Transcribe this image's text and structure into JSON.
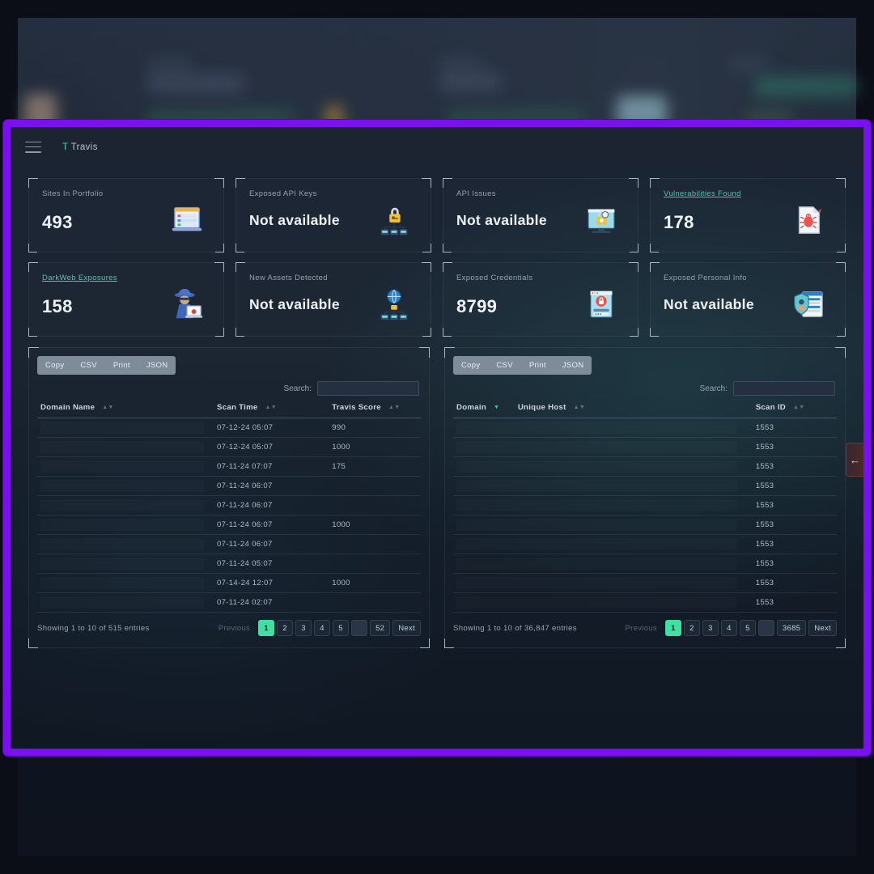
{
  "header": {
    "brand_initial": "T",
    "brand_name": "Travis",
    "menu_icon": "hamburger-icon"
  },
  "accent": {
    "teal": "#3ccfae",
    "green": "#3ee0a6",
    "frame_purple": "#7b0ff0"
  },
  "kpi_cards": [
    {
      "label": "Sites In Portfolio",
      "value": "493",
      "is_link": false,
      "icon": "domains-browser-icon"
    },
    {
      "label": "Exposed API Keys",
      "value": "Not available",
      "is_link": false,
      "icon": "api-key-lock-network-icon"
    },
    {
      "label": "API Issues",
      "value": "Not available",
      "is_link": false,
      "icon": "api-lock-gear-monitor-icon"
    },
    {
      "label": "Vulnerabilities Found",
      "value": "178",
      "is_link": true,
      "icon": "bug-document-icon"
    },
    {
      "label": "DarkWeb Exposures",
      "value": "158",
      "is_link": true,
      "icon": "hacker-spy-laptop-icon"
    },
    {
      "label": "New Assets Detected",
      "value": "Not available",
      "is_link": false,
      "icon": "globe-network-assets-icon"
    },
    {
      "label": "Exposed Credentials",
      "value": "8799",
      "is_link": false,
      "icon": "credentials-lock-form-icon"
    },
    {
      "label": "Exposed Personal Info",
      "value": "Not available",
      "is_link": false,
      "icon": "personal-info-shield-icon"
    }
  ],
  "export_buttons": [
    "Copy",
    "CSV",
    "Print",
    "JSON"
  ],
  "search": {
    "label": "Search:",
    "value": "",
    "placeholder": ""
  },
  "left_table": {
    "columns": [
      {
        "label": "Domain Name",
        "sorted": false
      },
      {
        "label": "Scan Time",
        "sorted": false
      },
      {
        "label": "Travis Score",
        "sorted": false
      }
    ],
    "rows": [
      {
        "domain": "",
        "scan_time": "07-12-24 05:07",
        "score": "990"
      },
      {
        "domain": "",
        "scan_time": "07-12-24 05:07",
        "score": "1000"
      },
      {
        "domain": "",
        "scan_time": "07-11-24 07:07",
        "score": "175"
      },
      {
        "domain": "",
        "scan_time": "07-11-24 06:07",
        "score": ""
      },
      {
        "domain": "",
        "scan_time": "07-11-24 06:07",
        "score": ""
      },
      {
        "domain": "",
        "scan_time": "07-11-24 06:07",
        "score": "1000"
      },
      {
        "domain": "",
        "scan_time": "07-11-24 06:07",
        "score": ""
      },
      {
        "domain": "",
        "scan_time": "07-11-24 05:07",
        "score": ""
      },
      {
        "domain": "",
        "scan_time": "07-14-24 12:07",
        "score": "1000"
      },
      {
        "domain": "",
        "scan_time": "07-11-24 02:07",
        "score": ""
      }
    ],
    "showing": "Showing 1 to 10 of 515 entries",
    "pager": {
      "previous": "Previous",
      "pages": [
        "1",
        "2",
        "3",
        "4",
        "5",
        "…",
        "52"
      ],
      "current": "1",
      "next": "Next"
    }
  },
  "right_table": {
    "columns": [
      {
        "label": "Domain",
        "sorted": true
      },
      {
        "label": "Unique Host",
        "sorted": false
      },
      {
        "label": "Scan ID",
        "sorted": false
      }
    ],
    "rows": [
      {
        "domain": "",
        "unique_host": "",
        "scan_id": "1553"
      },
      {
        "domain": "",
        "unique_host": "",
        "scan_id": "1553"
      },
      {
        "domain": "",
        "unique_host": "",
        "scan_id": "1553"
      },
      {
        "domain": "",
        "unique_host": "",
        "scan_id": "1553"
      },
      {
        "domain": "",
        "unique_host": "",
        "scan_id": "1553"
      },
      {
        "domain": "",
        "unique_host": "",
        "scan_id": "1553"
      },
      {
        "domain": "",
        "unique_host": "",
        "scan_id": "1553"
      },
      {
        "domain": "",
        "unique_host": "",
        "scan_id": "1553"
      },
      {
        "domain": "",
        "unique_host": "",
        "scan_id": "1553"
      },
      {
        "domain": "",
        "unique_host": "",
        "scan_id": "1553"
      }
    ],
    "showing": "Showing 1 to 10 of 36,847 entries",
    "pager": {
      "previous": "Previous",
      "pages": [
        "1",
        "2",
        "3",
        "4",
        "5",
        "…",
        "3685"
      ],
      "current": "1",
      "next": "Next"
    }
  },
  "collapse_handle": {
    "icon": "arrow-left-icon",
    "glyph": "←"
  }
}
